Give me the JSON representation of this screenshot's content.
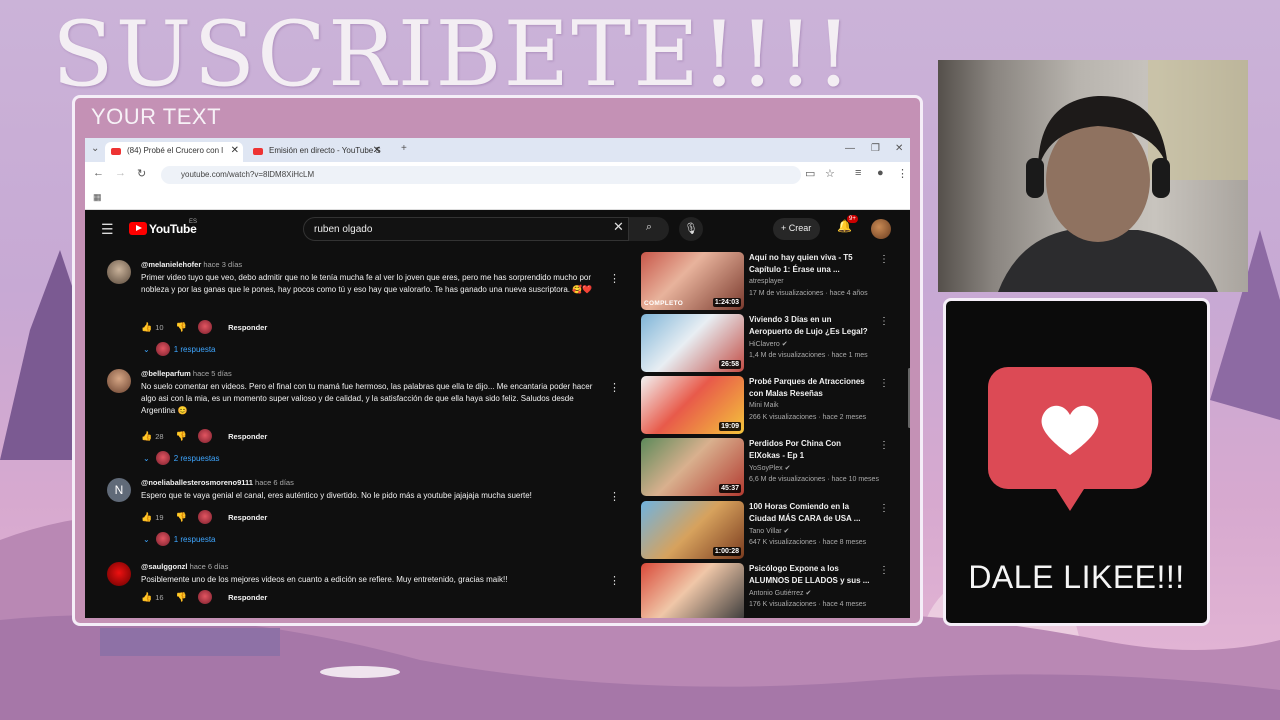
{
  "overlay": {
    "headline": "SUSCRIBETE!!!!",
    "panel_label": "YOUR TEXT",
    "like_text": "DALE LIKEE!!!"
  },
  "browser": {
    "tabs": [
      {
        "label": "(84) Probé el Crucero con l",
        "active": true
      },
      {
        "label": "Emisión en directo - YouTube S",
        "active": false
      }
    ],
    "url": "youtube.com/watch?v=8lDM8XiHcLM"
  },
  "youtube": {
    "logo": "YouTube",
    "region": "ES",
    "search_value": "ruben olgado",
    "create_label": "Crear",
    "notif_badge": "9+",
    "reply_label": "Responder"
  },
  "comments": [
    {
      "author": "@melanielehofer",
      "time": "hace 3 días",
      "text": "Primer video tuyo que veo, debo admitir que no le tenía mucha fe al ver lo joven que eres, pero me has sorprendido mucho por nobleza y por las ganas que le pones, hay pocos como tú y eso hay que valorarlo. Te has ganado una nueva suscriptora. 🥰❤️",
      "likes": "10",
      "replies": "1 respuesta"
    },
    {
      "author": "@belleparfum",
      "time": "hace 5 días",
      "text": "No suelo comentar en videos. Pero el final con tu mamá fue hermoso, las palabras que ella te dijo... Me encantaria poder hacer algo asi con la mia, es un momento super valioso y de calidad, y la satisfacción de que ella haya sido feliz. Saludos desde Argentina 😊",
      "likes": "28",
      "replies": "2 respuestas"
    },
    {
      "author": "@noeliaballesterosmoreno9111",
      "time": "hace 6 días",
      "text": "Espero que te vaya genial el canal, eres auténtico y divertido. No le pido más a youtube jajajaja mucha suerte!",
      "likes": "19",
      "replies": "1 respuesta",
      "initial": "N"
    },
    {
      "author": "@saulggonzl",
      "time": "hace 6 días",
      "text": "Posiblemente uno de los mejores videos en cuanto a edición se refiere. Muy entretenido, gracias maik!!",
      "likes": "16",
      "replies": ""
    }
  ],
  "sidebar": [
    {
      "title": "Aquí no hay quien viva - T5 Capítulo 1: Érase una ...",
      "channel": "atresplayer",
      "meta": "17 M de visualizaciones · hace 4 años",
      "duration": "1:24:03",
      "badge": "COMPLETO"
    },
    {
      "title": "Viviendo 3 Días en un Aeropuerto de Lujo ¿Es Legal?",
      "channel": "HiClavero",
      "meta": "1,4 M de visualizaciones · hace 1 mes",
      "duration": "26:58"
    },
    {
      "title": "Probé Parques de Atracciones con Malas Reseñas",
      "channel": "Mini Maik",
      "meta": "266 K visualizaciones · hace 2 meses",
      "duration": "19:09"
    },
    {
      "title": "Perdidos Por China Con ElXokas - Ep 1",
      "channel": "YoSoyPlex",
      "meta": "6,6 M de visualizaciones · hace 10 meses",
      "duration": "45:37"
    },
    {
      "title": "100 Horas Comiendo en la Ciudad MÁS CARA de USA ...",
      "channel": "Tano Villar",
      "meta": "647 K visualizaciones · hace 8 meses",
      "duration": "1:00:28"
    },
    {
      "title": "Psicólogo Expone a los ALUMNOS DE LLADOS y sus ...",
      "channel": "Antonio Gutiérrez",
      "meta": "176 K visualizaciones · hace 4 meses",
      "duration": ""
    }
  ],
  "colors": {
    "accent": "#ff0000",
    "link": "#3ea6ff",
    "like_heart_bg": "#dc4a55"
  }
}
